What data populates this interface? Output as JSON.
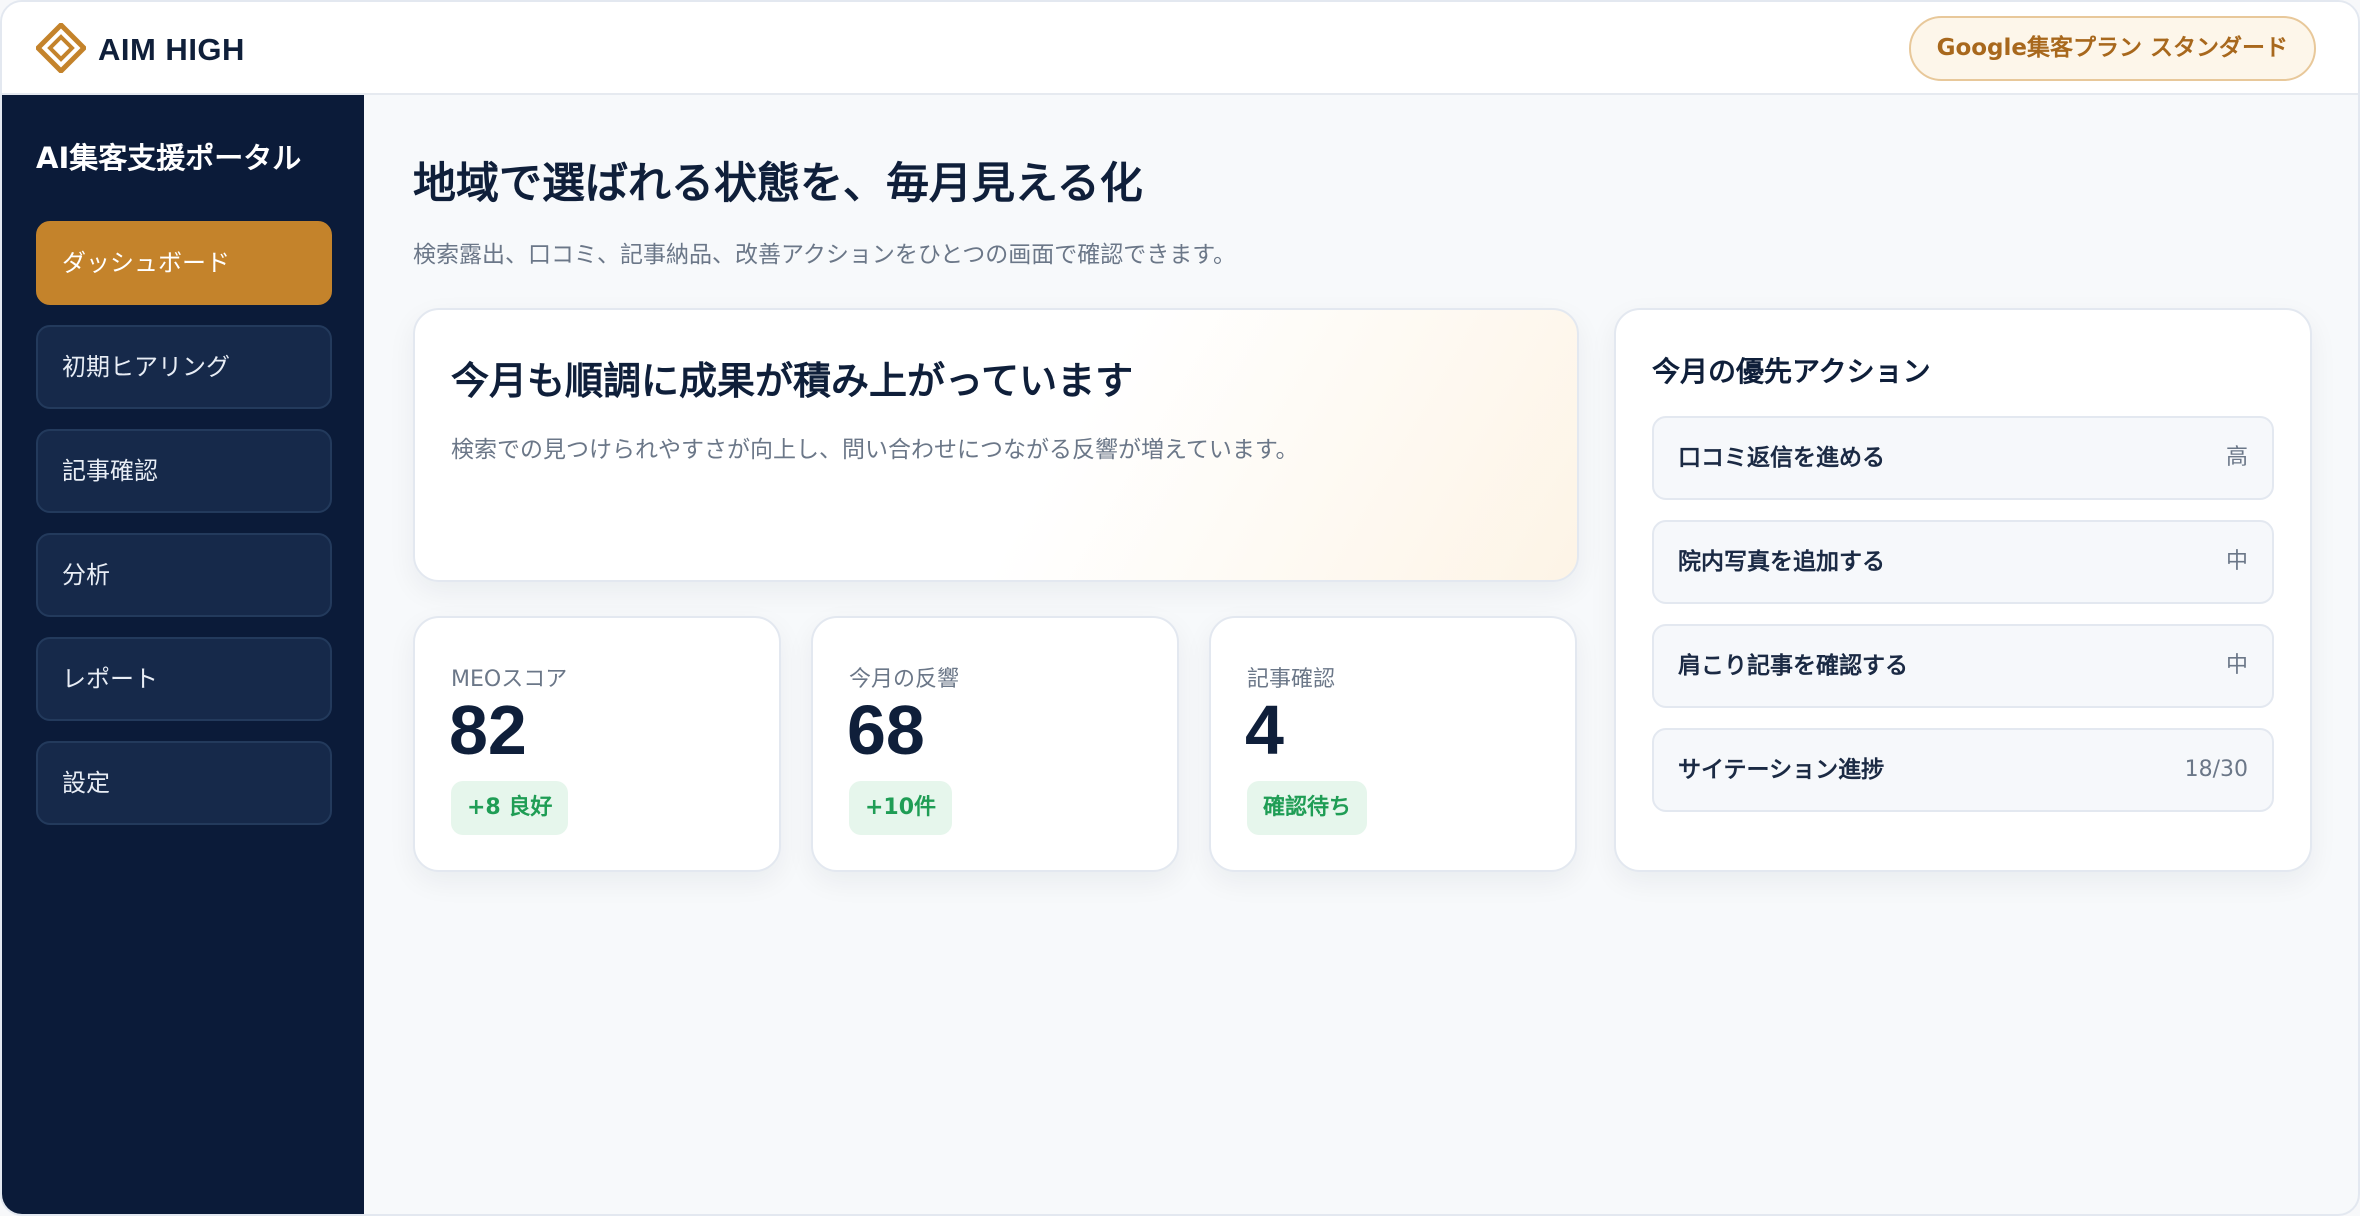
{
  "header": {
    "brand": "AIM HIGH",
    "plan_badge": "Google集客プラン スタンダード"
  },
  "sidebar": {
    "title": "AI集客支援ポータル",
    "items": [
      {
        "label": "ダッシュボード",
        "active": true
      },
      {
        "label": "初期ヒアリング",
        "active": false
      },
      {
        "label": "記事確認",
        "active": false
      },
      {
        "label": "分析",
        "active": false
      },
      {
        "label": "レポート",
        "active": false
      },
      {
        "label": "設定",
        "active": false
      }
    ]
  },
  "main": {
    "title": "地域で選ばれる状態を、毎月見える化",
    "subtitle": "検索露出、口コミ、記事納品、改善アクションをひとつの画面で確認できます。",
    "hero": {
      "title": "今月も順調に成果が積み上がっています",
      "text": "検索での見つけられやすさが向上し、問い合わせにつながる反響が増えています。"
    },
    "kpis": [
      {
        "label": "MEOスコア",
        "value": "82",
        "badge": "+8 良好"
      },
      {
        "label": "今月の反響",
        "value": "68",
        "badge": "+10件"
      },
      {
        "label": "記事確認",
        "value": "4",
        "badge": "確認待ち"
      }
    ],
    "actions": {
      "title": "今月の優先アクション",
      "items": [
        {
          "label": "口コミ返信を進める",
          "meta": "高"
        },
        {
          "label": "院内写真を追加する",
          "meta": "中"
        },
        {
          "label": "肩こり記事を確認する",
          "meta": "中"
        },
        {
          "label": "サイテーション進捗",
          "meta": "18/30"
        }
      ]
    }
  },
  "colors": {
    "navy": "#0b1b39",
    "accent": "#c4832b",
    "success": "#1f9d55",
    "success_bg": "#e6f6ec"
  }
}
